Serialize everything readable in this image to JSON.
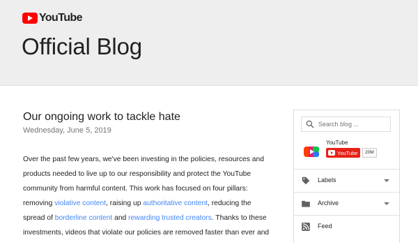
{
  "header": {
    "logo_text": "YouTube",
    "blog_title": "Official Blog"
  },
  "post": {
    "title": "Our ongoing work to tackle hate",
    "date": "Wednesday, June 5, 2019",
    "body": {
      "s1": "Over the past few years, we've been investing in the policies, resources and products needed to live up to our responsibility and protect the YouTube community from harmful content. This work has focused on four pillars: removing ",
      "link1": "violative content",
      "s2": ", raising up ",
      "link2": "authoritative content",
      "s3": ", reducing the spread of ",
      "link3": "borderline content",
      "s4": " and ",
      "link4": "rewarding trusted creators",
      "s5": ". Thanks to these investments, videos that violate our policies are removed faster than ever and"
    }
  },
  "sidebar": {
    "search_placeholder": "Search blog ...",
    "channel_name": "YouTube",
    "subscribe_label": "YouTube",
    "subscriber_count": "20M",
    "items": [
      {
        "label": "Labels",
        "icon": "label-tag-icon",
        "has_dropdown": true
      },
      {
        "label": "Archive",
        "icon": "folder-icon",
        "has_dropdown": true
      },
      {
        "label": "Feed",
        "icon": "rss-feed-icon",
        "has_dropdown": false
      }
    ]
  },
  "colors": {
    "header_bg": "#eeeeee",
    "link": "#4285f4",
    "brand_red": "#ff0000",
    "subscribe_red": "#e62117"
  }
}
